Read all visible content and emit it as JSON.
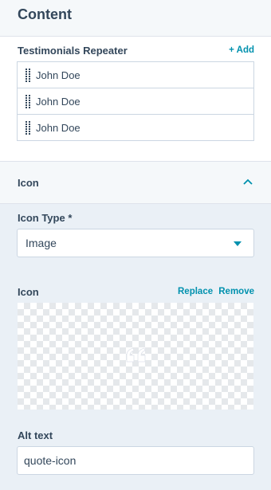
{
  "header": {
    "title": "Content"
  },
  "repeater": {
    "label": "Testimonials Repeater",
    "add_label": "+ Add",
    "items": [
      {
        "label": "John Doe"
      },
      {
        "label": "John Doe"
      },
      {
        "label": "John Doe"
      }
    ]
  },
  "icon_section": {
    "title": "Icon",
    "expanded": true,
    "icon_type": {
      "label": "Icon Type *",
      "value": "Image"
    },
    "icon_field": {
      "label": "Icon",
      "replace_label": "Replace",
      "remove_label": "Remove"
    },
    "alt_text": {
      "label": "Alt text",
      "value": "quote-icon"
    }
  },
  "colors": {
    "accent": "#0091ae",
    "text": "#33475b",
    "border": "#cbd6e2"
  }
}
